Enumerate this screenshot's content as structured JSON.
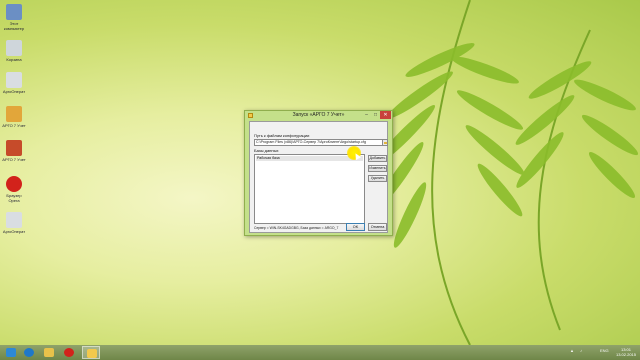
{
  "desktop": {
    "icons": [
      {
        "label": "Этот компьютер",
        "icon": "computer-icon",
        "color": "#6b8fc4"
      },
      {
        "label": "Корзина",
        "icon": "recycle-bin-icon",
        "color": "#cfd6db"
      },
      {
        "label": "АргоОперат",
        "icon": "argo-operator-icon",
        "color": "#d9dde2"
      },
      {
        "label": "АРГО 7 Учет",
        "icon": "argo-accounting-icon",
        "color": "#e2a63a"
      },
      {
        "label": "АРГО 7 Учет",
        "icon": "argo-pen-icon",
        "color": "#c64b2a"
      },
      {
        "label": "Браузер Opera",
        "icon": "opera-icon",
        "color": "#d2221b"
      },
      {
        "label": "АргоОперат",
        "icon": "argo-operator-icon",
        "color": "#d9dde2"
      }
    ]
  },
  "dialog": {
    "title": "Запуск «АРГО 7 Учет»",
    "path_label": "Путь к файлам конфигурации",
    "path_value": "C:\\Program Files (x86)\\АРГО-Сервер 7\\АргоКлиент\\Argo\\startup.cfg",
    "db_label": "Базы данных",
    "db_items": [
      "Рабочая база"
    ],
    "add_button": "Добавить",
    "edit_button": "Изменить",
    "delete_button": "Удалить",
    "status": "Сервер = WIN-SK4GADGBG, База данных = ARGO_7",
    "ok_button": "OK",
    "cancel_button": "Отмена",
    "close_glyph": "✕",
    "minimize_glyph": "–",
    "maximize_glyph": "□"
  },
  "taskbar": {
    "items": [
      {
        "icon": "windows-start-icon",
        "color": "#2d89d6"
      },
      {
        "icon": "internet-explorer-icon",
        "color": "#1f78c8"
      },
      {
        "icon": "file-explorer-icon",
        "color": "#e8c24a"
      },
      {
        "icon": "opera-icon",
        "color": "#d2221b"
      },
      {
        "icon": "argo-accounting-icon",
        "color": "#f2c94c"
      }
    ],
    "language": "ENG",
    "time": "13:01",
    "date": "13.02.2015"
  },
  "colors": {
    "accent": "#c8413b",
    "wallpaper_light": "#f4f6c6",
    "wallpaper_dark": "#a9c94a"
  }
}
